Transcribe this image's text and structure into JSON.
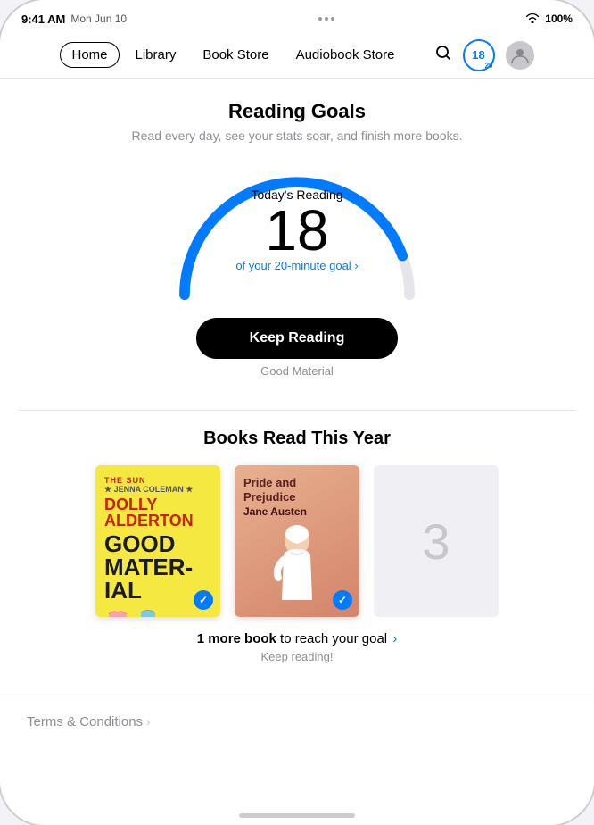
{
  "status_bar": {
    "time": "9:41 AM",
    "date": "Mon Jun 10",
    "dots": [
      "•",
      "•",
      "•"
    ],
    "wifi": "WiFi",
    "battery": "100%"
  },
  "nav": {
    "items": [
      {
        "label": "Home",
        "active": true
      },
      {
        "label": "Library",
        "active": false
      },
      {
        "label": "Book Store",
        "active": false
      },
      {
        "label": "Audiobook Store",
        "active": false
      }
    ],
    "badge_number": "18",
    "badge_sub": "20"
  },
  "reading_goals": {
    "title": "Reading Goals",
    "subtitle": "Read every day, see your stats soar, and finish more books.",
    "today_label": "Today's Reading",
    "minutes": "18",
    "goal_text": "of your 20-minute goal",
    "goal_chevron": "›",
    "button_label": "Keep Reading",
    "button_subtitle": "Good Material",
    "gauge_progress": 90
  },
  "books_section": {
    "title": "Books Read This Year",
    "books": [
      {
        "title": "Good Material",
        "author": "DOLLY ALDERTON",
        "style": "good-material",
        "checked": true
      },
      {
        "title": "Pride and Prejudice",
        "author": "Jane Austen",
        "style": "pride",
        "checked": true
      },
      {
        "placeholder_num": "3",
        "style": "placeholder"
      }
    ],
    "goal_text_part1": "1 more book",
    "goal_text_part2": " to reach your goal",
    "goal_chevron": "›",
    "keep_reading": "Keep reading!"
  },
  "terms": {
    "label": "Terms & Conditions",
    "chevron": "›"
  }
}
